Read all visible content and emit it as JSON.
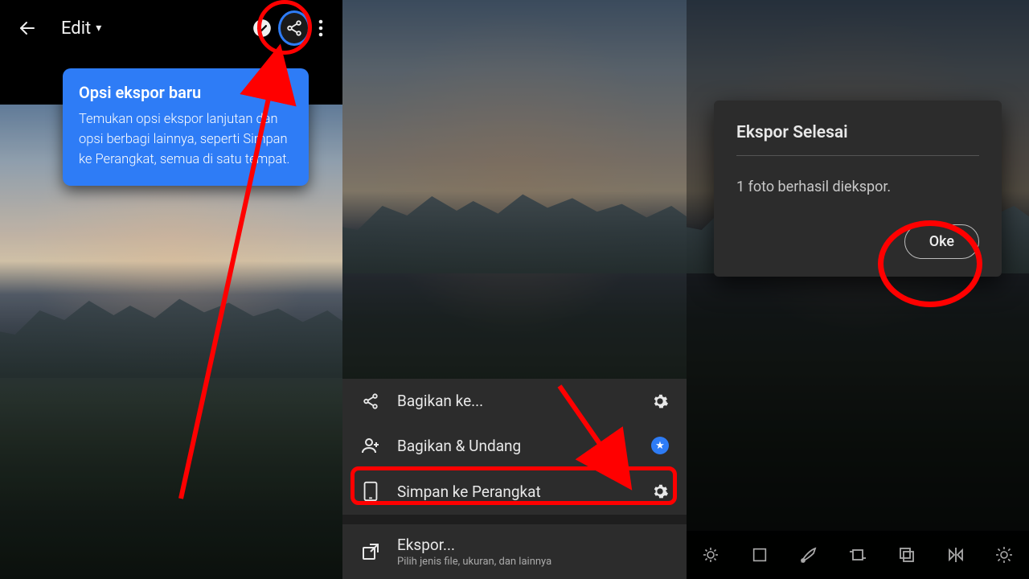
{
  "panel1": {
    "edit_label": "Edit",
    "tooltip": {
      "title": "Opsi ekspor baru",
      "body": "Temukan opsi ekspor lanjutan dan opsi berbagi lainnya, seperti Simpan ke Perangkat, semua di satu tempat."
    },
    "icons": {
      "back": "back-arrow-icon",
      "cloud_sync": "cloud-check-icon",
      "share": "share-icon",
      "more": "more-vertical-icon",
      "dropdown": "chevron-down-icon"
    }
  },
  "panel2": {
    "menu": [
      {
        "label": "Bagikan ke...",
        "icon": "share-icon",
        "right": "gear-icon"
      },
      {
        "label": "Bagikan & Undang",
        "icon": "add-person-icon",
        "right": "star-badge"
      },
      {
        "label": "Simpan ke Perangkat",
        "icon": "device-icon",
        "right": "gear-icon",
        "highlight": true
      },
      {
        "label": "Ekspor...",
        "sub": "Pilih jenis file, ukuran, dan lainnya",
        "icon": "export-icon",
        "right": ""
      }
    ]
  },
  "panel3": {
    "dialog": {
      "title": "Ekspor Selesai",
      "message": "1 foto berhasil diekspor.",
      "ok_label": "Oke"
    },
    "tools": [
      "healing-icon",
      "square-crop-icon",
      "brush-icon",
      "transform-icon",
      "copy-icon",
      "flip-icon",
      "brightness-icon"
    ]
  },
  "colors": {
    "accent": "#2e7cf6",
    "annotation": "#ff0000"
  }
}
